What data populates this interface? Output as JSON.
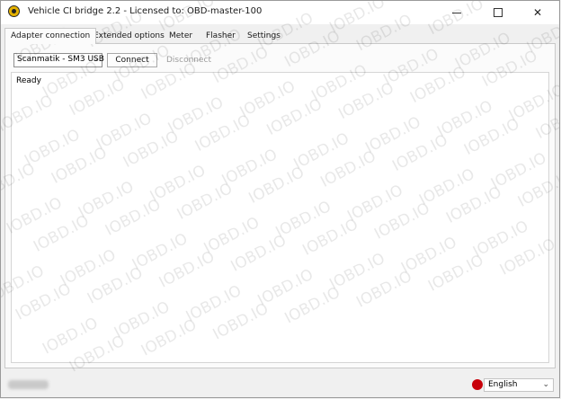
{
  "window": {
    "title": "Vehicle CI bridge  2.2 - Licensed to: OBD-master-100"
  },
  "tabs": [
    {
      "label": "Adapter connection",
      "active": true
    },
    {
      "label": "Extended options",
      "active": false
    },
    {
      "label": "Meter",
      "active": false
    },
    {
      "label": "Flasher",
      "active": false
    },
    {
      "label": "Settings",
      "active": false
    }
  ],
  "connection": {
    "adapter_selected": "Scanmatik - SM3 USB",
    "connect_label": "Connect",
    "disconnect_label": "Disconnect",
    "disconnect_enabled": false
  },
  "log": {
    "text": "Ready"
  },
  "watermark": {
    "text": "IOBD.IO"
  },
  "statusbar": {
    "status_color": "#c8000a",
    "language_selected": "English"
  }
}
